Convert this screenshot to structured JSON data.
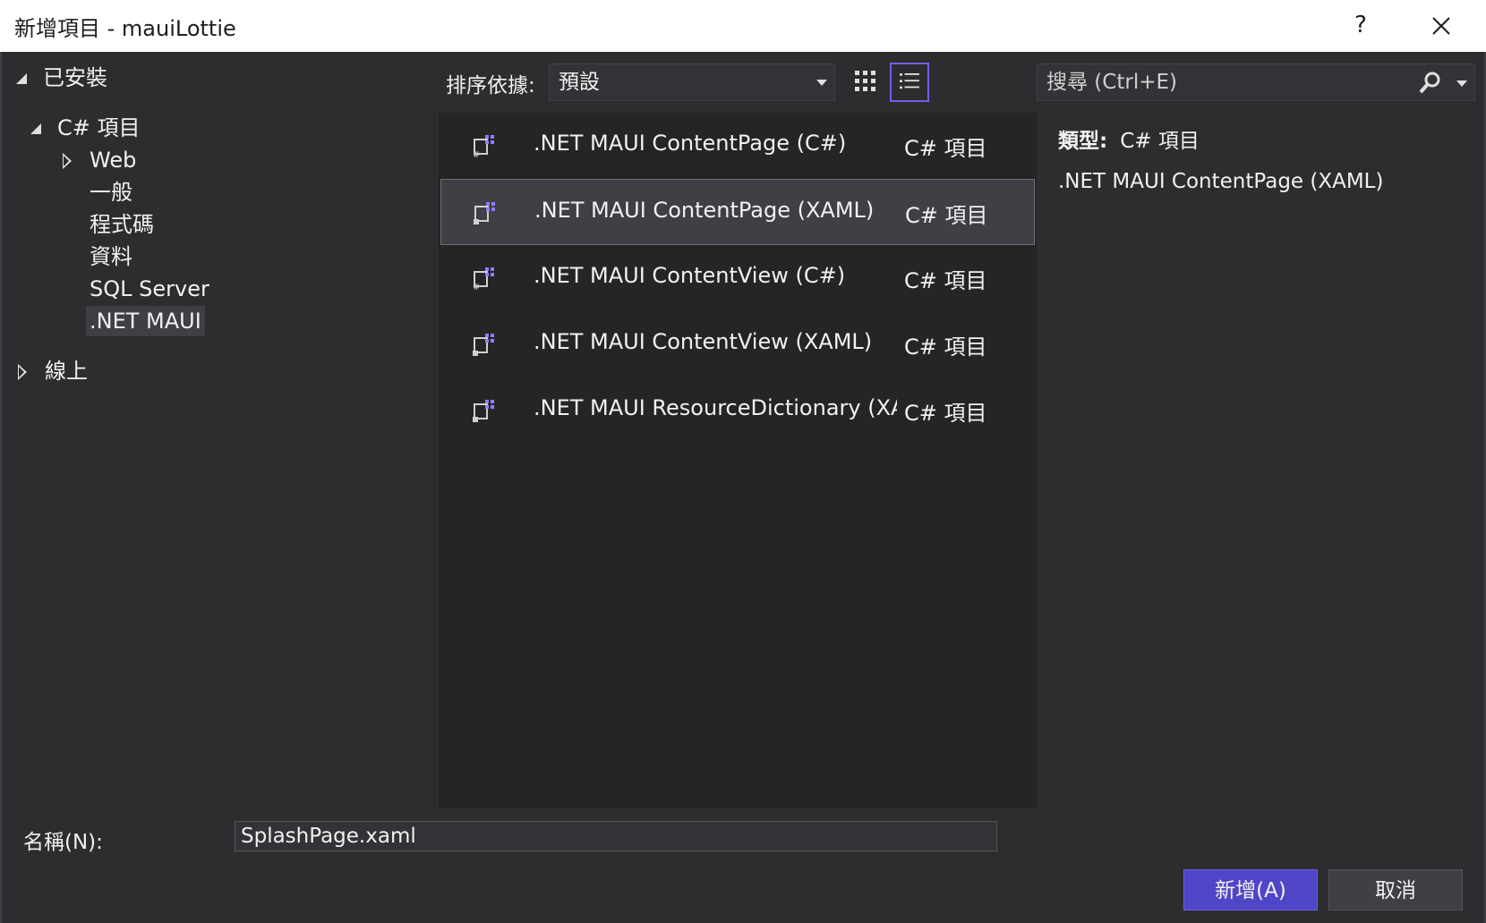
{
  "window": {
    "title": "新增項目 - mauiLottie",
    "help_label": "?"
  },
  "tree": {
    "installed": "已安裝",
    "csharp_items": "C# 項目",
    "children": [
      "Web",
      "一般",
      "程式碼",
      "資料",
      "SQL Server",
      ".NET MAUI"
    ],
    "online": "線上"
  },
  "toolbar": {
    "sort_label": "排序依據:",
    "sort_value": "預設",
    "search_placeholder": "搜尋 (Ctrl+E)"
  },
  "items": [
    {
      "name": ".NET MAUI ContentPage (C#)",
      "type": "C# 項目"
    },
    {
      "name": ".NET MAUI ContentPage (XAML)",
      "type": "C# 項目"
    },
    {
      "name": ".NET MAUI ContentView (C#)",
      "type": "C# 項目"
    },
    {
      "name": ".NET MAUI ContentView (XAML)",
      "type": "C# 項目"
    },
    {
      "name": ".NET MAUI ResourceDictionary (XA...",
      "type": "C# 項目"
    }
  ],
  "details": {
    "type_label": "類型:",
    "type_value": "C# 項目",
    "description": ".NET MAUI ContentPage (XAML)"
  },
  "footer": {
    "name_label": "名稱(N):",
    "name_value": "SplashPage.xaml",
    "add_button": "新增(A)",
    "cancel_button": "取消"
  },
  "colors": {
    "accent": "#5145c7",
    "background": "#2d2d30",
    "list_background": "#252526",
    "selection": "#3f3f46"
  }
}
